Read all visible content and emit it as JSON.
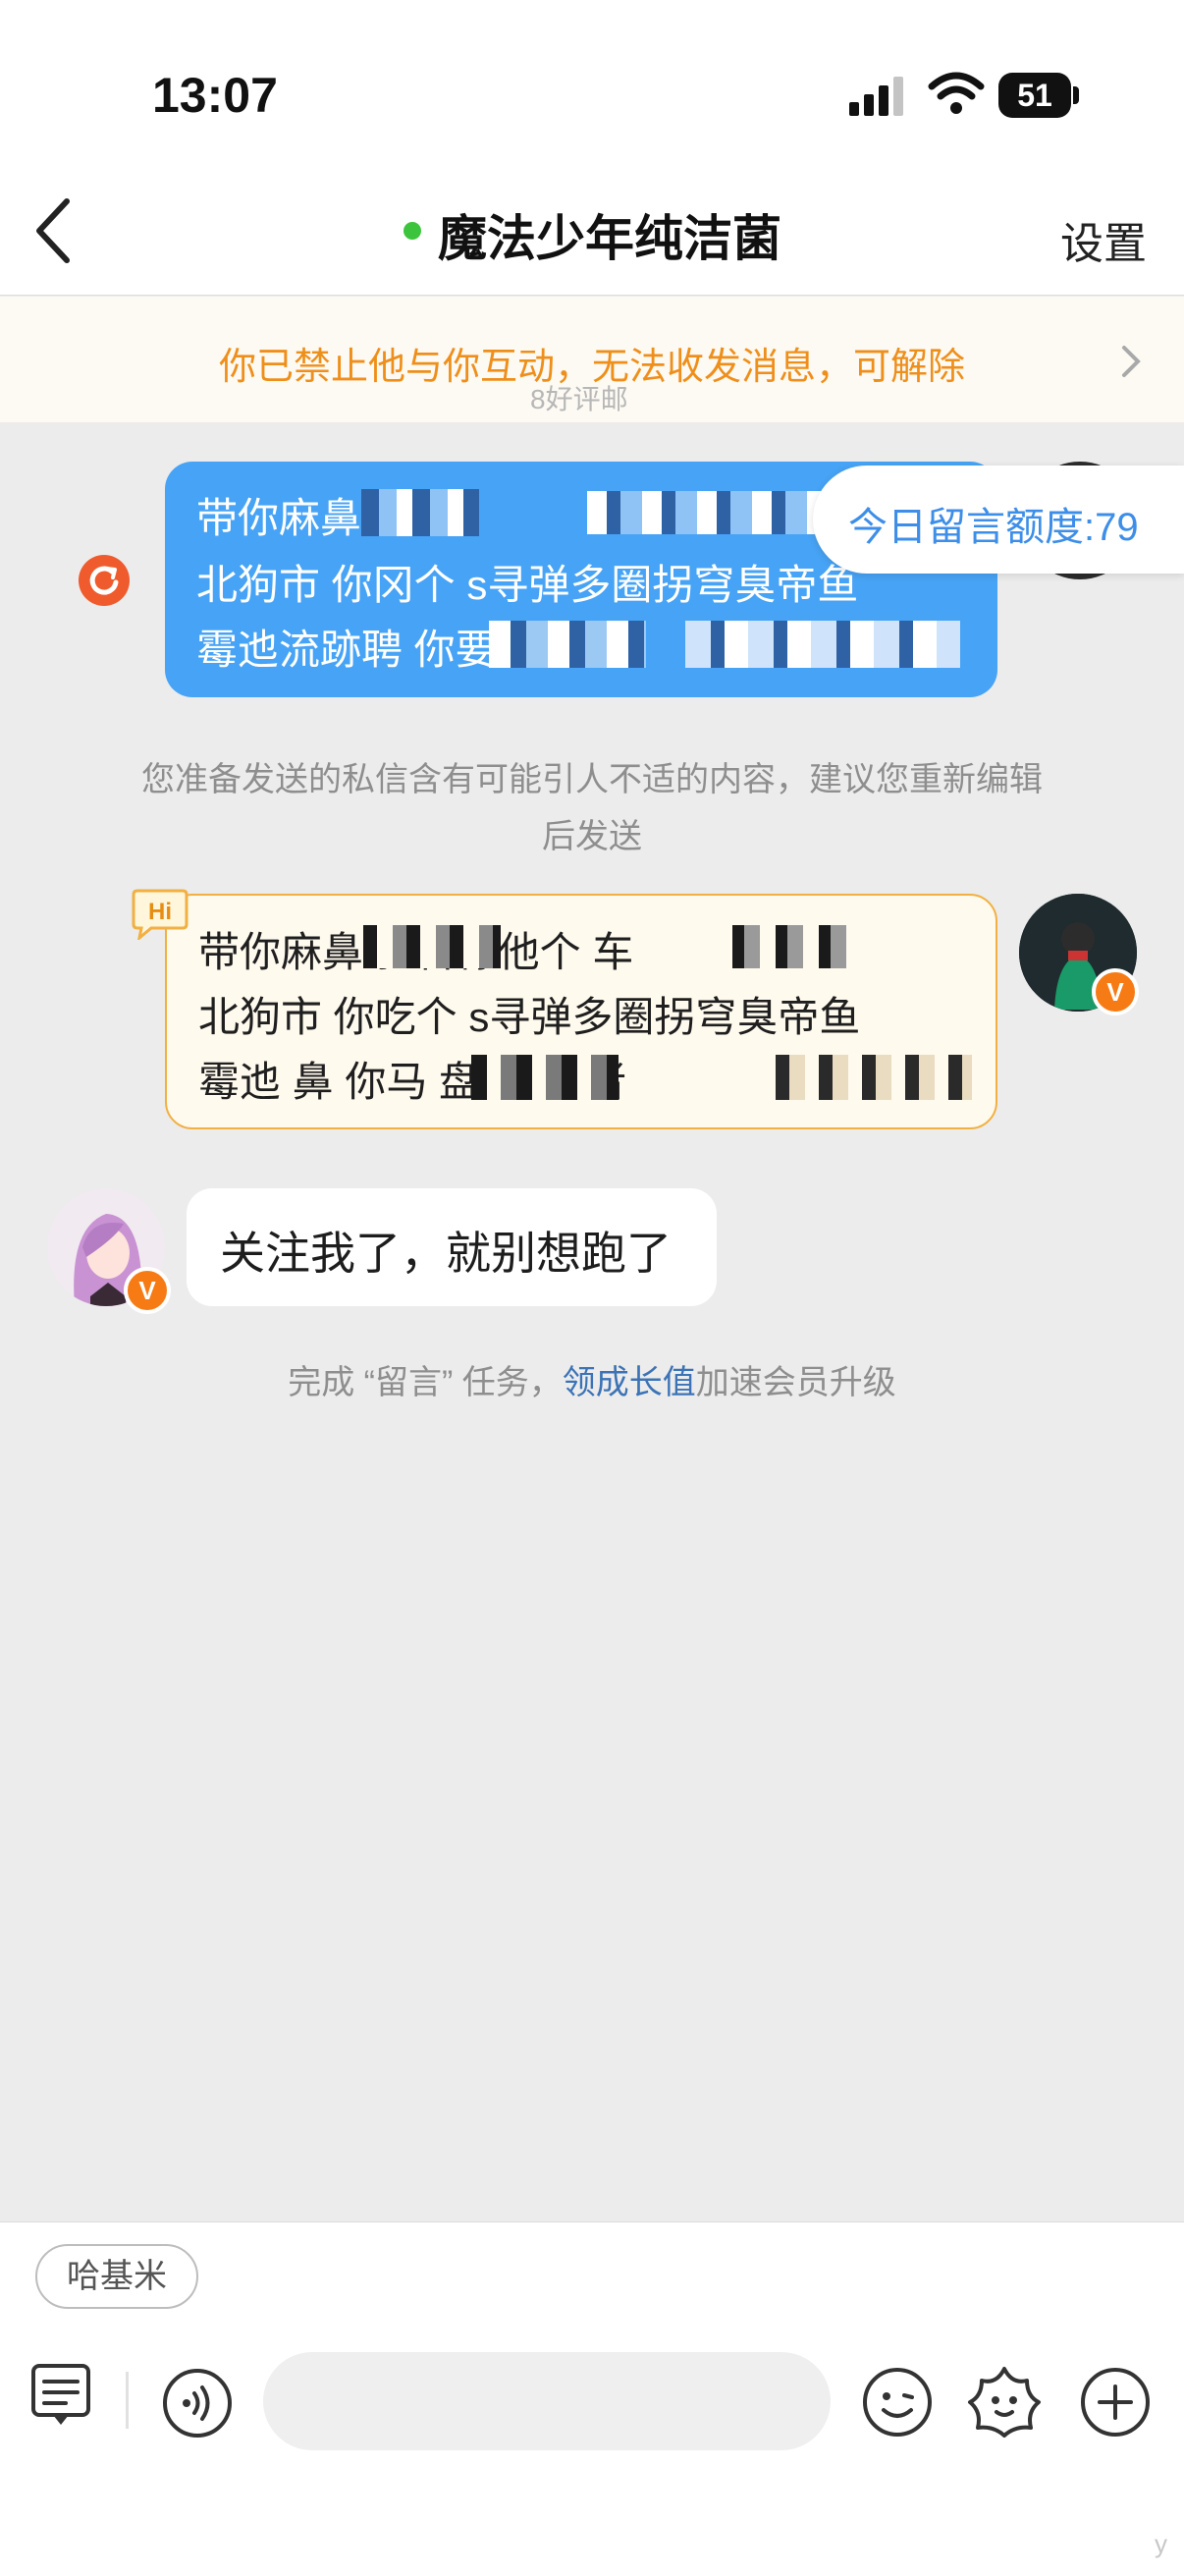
{
  "status_bar": {
    "time": "13:07",
    "battery": "51"
  },
  "header": {
    "title": "魔法少年纯洁菌",
    "settings_label": "设置"
  },
  "banner": {
    "text": "你已禁止他与你互动，无法收发消息，可解除",
    "ghost_text": "8好评邮"
  },
  "messages": {
    "sent": {
      "lines": [
        "带你麻鼻笑若",
        "北狗市 你冈个 s寻弹多圈拐穹臭帝鱼",
        "霉迆流跡聘 你要"
      ],
      "quota": "今日留言额度:79"
    },
    "warning": "您准备发送的私信含有可能引人不适的内容，建议您重新编辑后发送",
    "greeting": {
      "badge": "Hi",
      "lines": [
        "带你麻鼻  狂曹你他个  车",
        "北狗市 你吃个 s寻弹多圈拐穹臭帝鱼",
        "霉迆 鼻 你马 盘睡 黑 者"
      ]
    },
    "received": {
      "text": "关注我了，就别想跑了"
    },
    "task": {
      "prefix": "完成 “留言” 任务，",
      "link": "领成长值",
      "suffix": "加速会员升级"
    }
  },
  "bottom": {
    "suggestion_chip": "哈基米",
    "input_placeholder": ""
  },
  "watermark": "y",
  "colors": {
    "accent_blue": "#47a3f5",
    "banner_orange": "#ef8f1b",
    "online_green": "#3cc53c",
    "vip_orange": "#f77b14"
  }
}
